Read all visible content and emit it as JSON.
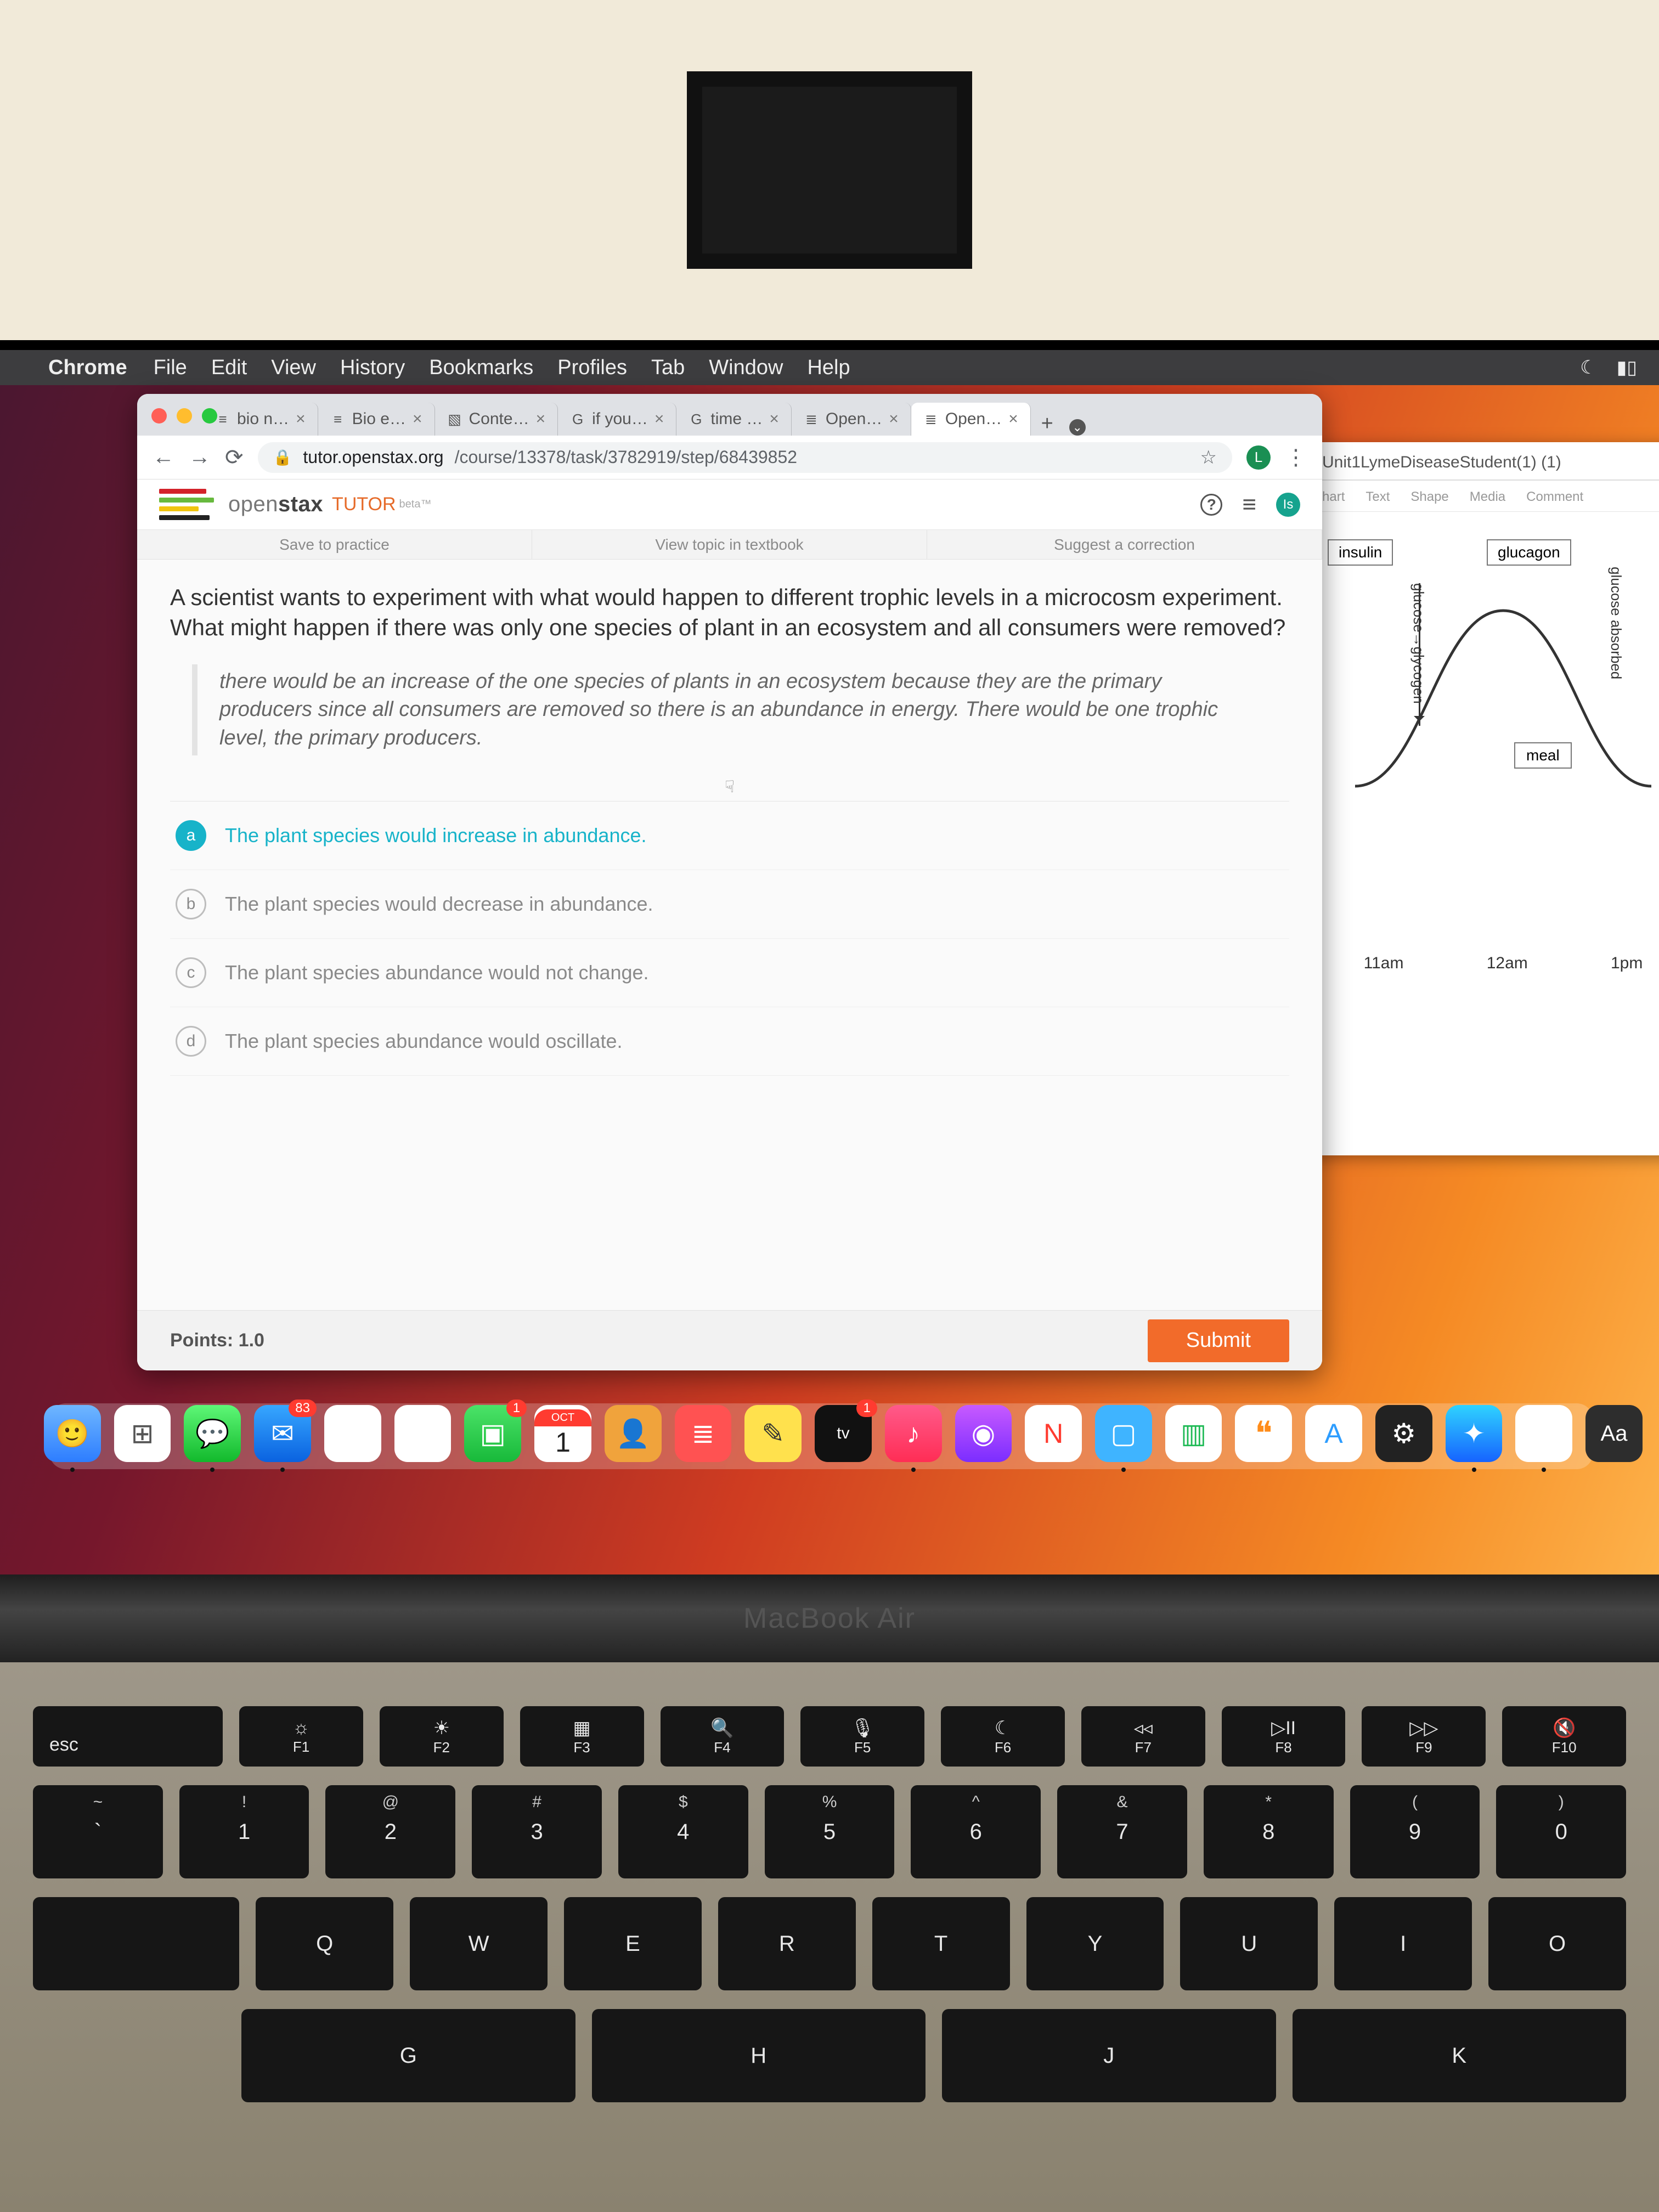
{
  "menubar": {
    "app": "Chrome",
    "items": [
      "File",
      "Edit",
      "View",
      "History",
      "Bookmarks",
      "Profiles",
      "Tab",
      "Window",
      "Help"
    ]
  },
  "tabs": [
    {
      "label": "bio n…",
      "fav": "≡"
    },
    {
      "label": "Bio e…",
      "fav": "≡"
    },
    {
      "label": "Conte…",
      "fav": "▧"
    },
    {
      "label": "if you…",
      "fav": "G"
    },
    {
      "label": "time …",
      "fav": "G"
    },
    {
      "label": "Open…",
      "fav": "≣"
    },
    {
      "label": "Open…",
      "fav": "≣",
      "active": true
    }
  ],
  "addr": {
    "host": "tutor.openstax.org",
    "path": "/course/13378/task/3782919/step/68439852"
  },
  "profile_initial": "L",
  "app": {
    "brand_left": "open",
    "brand_right": "stax",
    "tutor": "TUTOR",
    "beta": "beta™",
    "avatar": "Is",
    "subtabs": [
      "Save to practice",
      "View topic in textbook",
      "Suggest a correction"
    ]
  },
  "question": "A scientist wants to experiment with what would happen to different trophic levels in a microcosm experiment. What might happen if there was only one species of plant in an ecosystem and all consumers were removed?",
  "free_response": "there would be an increase of the one species of plants in an ecosystem because they are the primary producers since all consumers are removed so there is an abundance in energy. There would be one trophic level, the primary producers.",
  "answers": [
    {
      "letter": "a",
      "text": "The plant species would increase in abundance.",
      "selected": true
    },
    {
      "letter": "b",
      "text": "The plant species would decrease in abundance."
    },
    {
      "letter": "c",
      "text": "The plant species abundance would not change."
    },
    {
      "letter": "d",
      "text": "The plant species abundance would oscillate."
    }
  ],
  "points_label": "Points: 1.0",
  "submit_label": "Submit",
  "otherwin": {
    "title": "Unit1LymeDiseaseStudent(1) (1)",
    "tools": [
      "hart",
      "Text",
      "Shape",
      "Media",
      "Comment"
    ],
    "boxes": {
      "b1": "insulin",
      "b2": "glucagon",
      "meal": "meal"
    },
    "vlabels": {
      "v1": "glucose→glycogen",
      "v2": "glucose absorbed"
    },
    "x": [
      "11am",
      "12am",
      "1pm"
    ]
  },
  "dock": {
    "mail_badge": "83",
    "ft_badge": "1",
    "cal_month": "OCT",
    "cal_day": "1",
    "tv_badge": "1"
  },
  "hinge": "MacBook Air",
  "frow": [
    {
      "k": "esc"
    },
    {
      "g": "☼",
      "k": "F1"
    },
    {
      "g": "☀",
      "k": "F2"
    },
    {
      "g": "▦",
      "k": "F3"
    },
    {
      "g": "🔍",
      "k": "F4"
    },
    {
      "g": "🎙",
      "k": "F5"
    },
    {
      "g": "☾",
      "k": "F6"
    },
    {
      "g": "◃◃",
      "k": "F7"
    },
    {
      "g": "▷II",
      "k": "F8"
    },
    {
      "g": "▷▷",
      "k": "F9"
    },
    {
      "g": "🔇",
      "k": "F10"
    }
  ],
  "numrow": [
    {
      "t": "~",
      "b": "`"
    },
    {
      "t": "!",
      "b": "1"
    },
    {
      "t": "@",
      "b": "2"
    },
    {
      "t": "#",
      "b": "3"
    },
    {
      "t": "$",
      "b": "4"
    },
    {
      "t": "%",
      "b": "5"
    },
    {
      "t": "^",
      "b": "6"
    },
    {
      "t": "&",
      "b": "7"
    },
    {
      "t": "*",
      "b": "8"
    },
    {
      "t": "(",
      "b": "9"
    },
    {
      "t": ")",
      "b": "0"
    }
  ],
  "qrow": [
    "Q",
    "W",
    "E",
    "R",
    "T",
    "Y",
    "U",
    "I",
    "O"
  ],
  "arow": [
    "G",
    "H",
    "J",
    "K"
  ]
}
